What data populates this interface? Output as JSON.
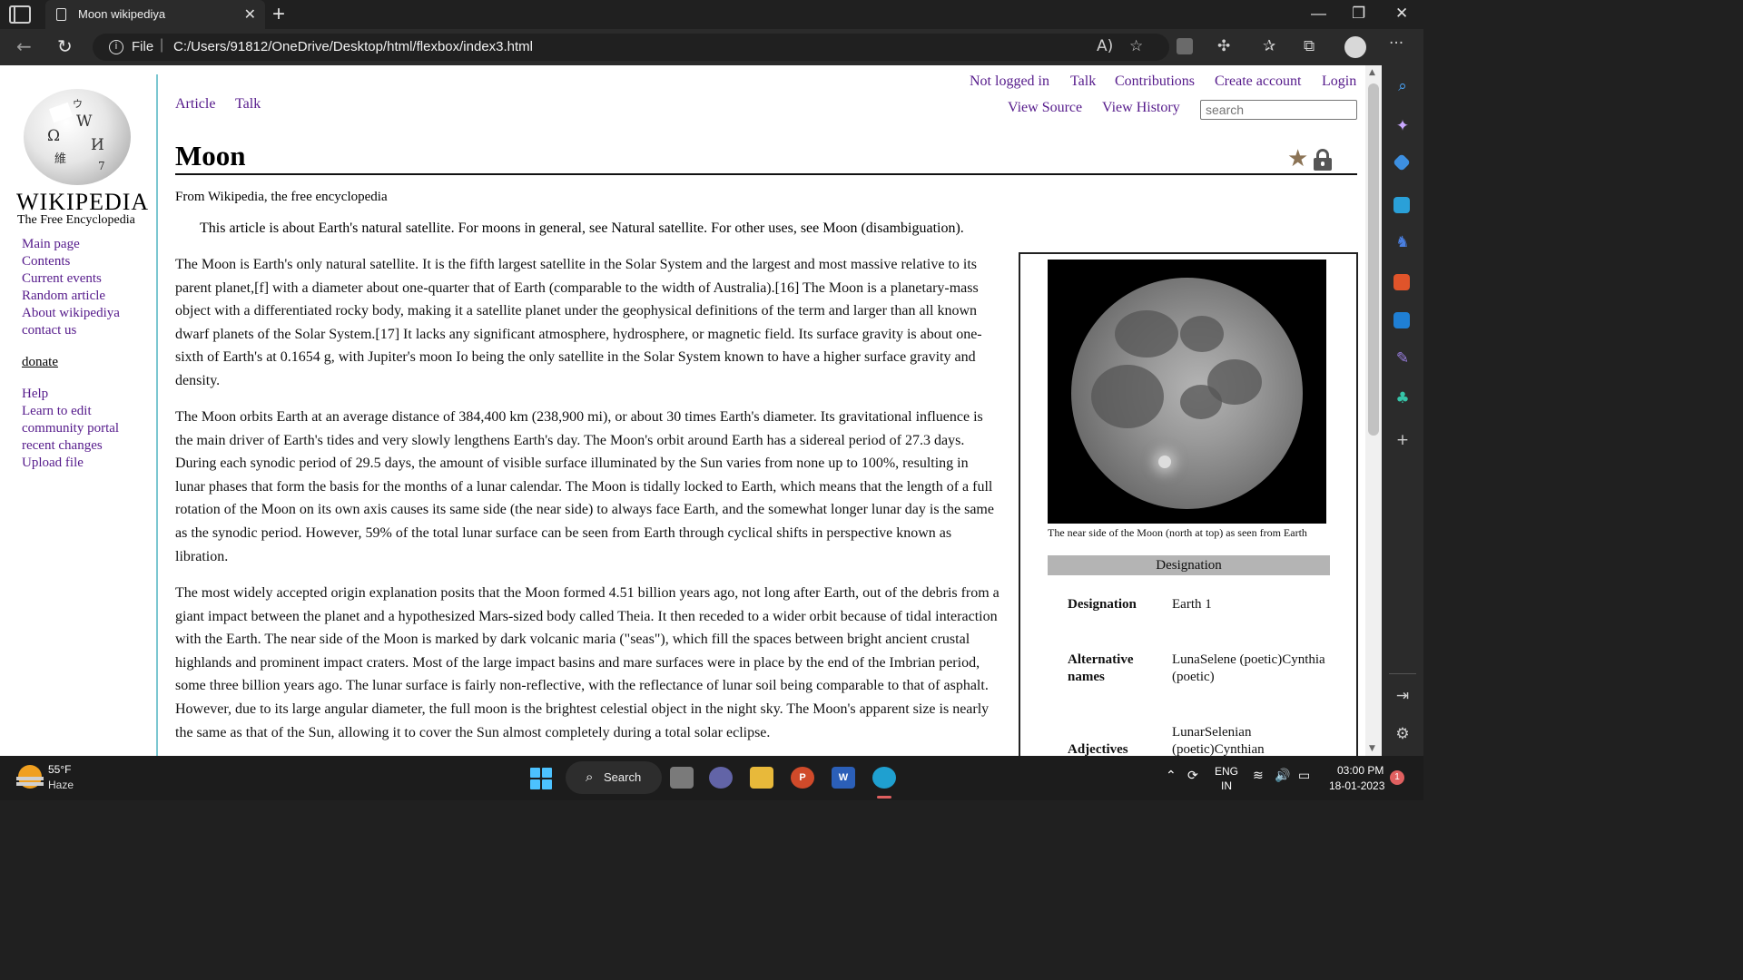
{
  "browser": {
    "tab_title": "Moon wikipediya",
    "tab_close": "✕",
    "new_tab": "+",
    "url_scheme": "File",
    "url_separator": "|",
    "url": "C:/Users/91812/OneDrive/Desktop/html/flexbox/index3.html",
    "info_glyph": "i",
    "window_controls": {
      "minimize": "—",
      "maximize": "❐",
      "close": "✕"
    }
  },
  "wiki_logo": {
    "wordmark": "WIKIPEDIA",
    "tagline": "The Free Encyclopedia"
  },
  "sidebar": {
    "nav": [
      "Main page",
      "Contents",
      "Current events",
      "Random article",
      "About wikipediya",
      "contact us"
    ],
    "donate": "donate",
    "help": [
      "Help",
      "Learn to edit",
      "community portal",
      "recent changes",
      "Upload file"
    ]
  },
  "top_links": {
    "personal": [
      "Not logged in",
      "Talk",
      "Contributions",
      "Create account",
      "Login"
    ],
    "namespaces": [
      "Article",
      "Talk"
    ],
    "views": [
      "View Source",
      "View History"
    ],
    "search_placeholder": "search"
  },
  "article": {
    "title": "Moon",
    "subtitle": "From Wikipedia, the free encyclopedia",
    "hatnote": "This article is about Earth's natural satellite. For moons in general, see Natural satellite. For other uses, see Moon (disambiguation).",
    "paragraphs": [
      "The Moon is Earth's only natural satellite. It is the fifth largest satellite in the Solar System and the largest and most massive relative to its parent planet,[f] with a diameter about one-quarter that of Earth (comparable to the width of Australia).[16] The Moon is a planetary-mass object with a differentiated rocky body, making it a satellite planet under the geophysical definitions of the term and larger than all known dwarf planets of the Solar System.[17] It lacks any significant atmosphere, hydrosphere, or magnetic field. Its surface gravity is about one-sixth of Earth's at 0.1654 g, with Jupiter's moon Io being the only satellite in the Solar System known to have a higher surface gravity and density.",
      "The Moon orbits Earth at an average distance of 384,400 km (238,900 mi), or about 30 times Earth's diameter. Its gravitational influence is the main driver of Earth's tides and very slowly lengthens Earth's day. The Moon's orbit around Earth has a sidereal period of 27.3 days. During each synodic period of 29.5 days, the amount of visible surface illuminated by the Sun varies from none up to 100%, resulting in lunar phases that form the basis for the months of a lunar calendar. The Moon is tidally locked to Earth, which means that the length of a full rotation of the Moon on its own axis causes its same side (the near side) to always face Earth, and the somewhat longer lunar day is the same as the synodic period. However, 59% of the total lunar surface can be seen from Earth through cyclical shifts in perspective known as libration.",
      "The most widely accepted origin explanation posits that the Moon formed 4.51 billion years ago, not long after Earth, out of the debris from a giant impact between the planet and a hypothesized Mars-sized body called Theia. It then receded to a wider orbit because of tidal interaction with the Earth. The near side of the Moon is marked by dark volcanic maria (\"seas\"), which fill the spaces between bright ancient crustal highlands and prominent impact craters. Most of the large impact basins and mare surfaces were in place by the end of the Imbrian period, some three billion years ago. The lunar surface is fairly non-reflective, with the reflectance of lunar soil being comparable to that of asphalt. However, due to its large angular diameter, the full moon is the brightest celestial object in the night sky. The Moon's apparent size is nearly the same as that of the Sun, allowing it to cover the Sun almost completely during a total solar eclipse."
    ]
  },
  "infobox": {
    "caption": "The near side of the Moon (north at top) as seen from Earth",
    "header": "Designation",
    "rows": [
      {
        "label": "Designation",
        "value": "Earth 1"
      },
      {
        "label": "Alternative names",
        "value": "LunaSelene (poetic)Cynthia (poetic)"
      },
      {
        "label": "Adjectives",
        "value": "LunarSelenian (poetic)Cynthian"
      }
    ]
  },
  "taskbar": {
    "weather_temp": "55°F",
    "weather_desc": "Haze",
    "search_label": "Search",
    "lang_top": "ENG",
    "lang_bottom": "IN",
    "time": "03:00 PM",
    "date": "18-01-2023",
    "notification_count": "1",
    "powerpoint_letter": "P",
    "word_letter": "W"
  }
}
